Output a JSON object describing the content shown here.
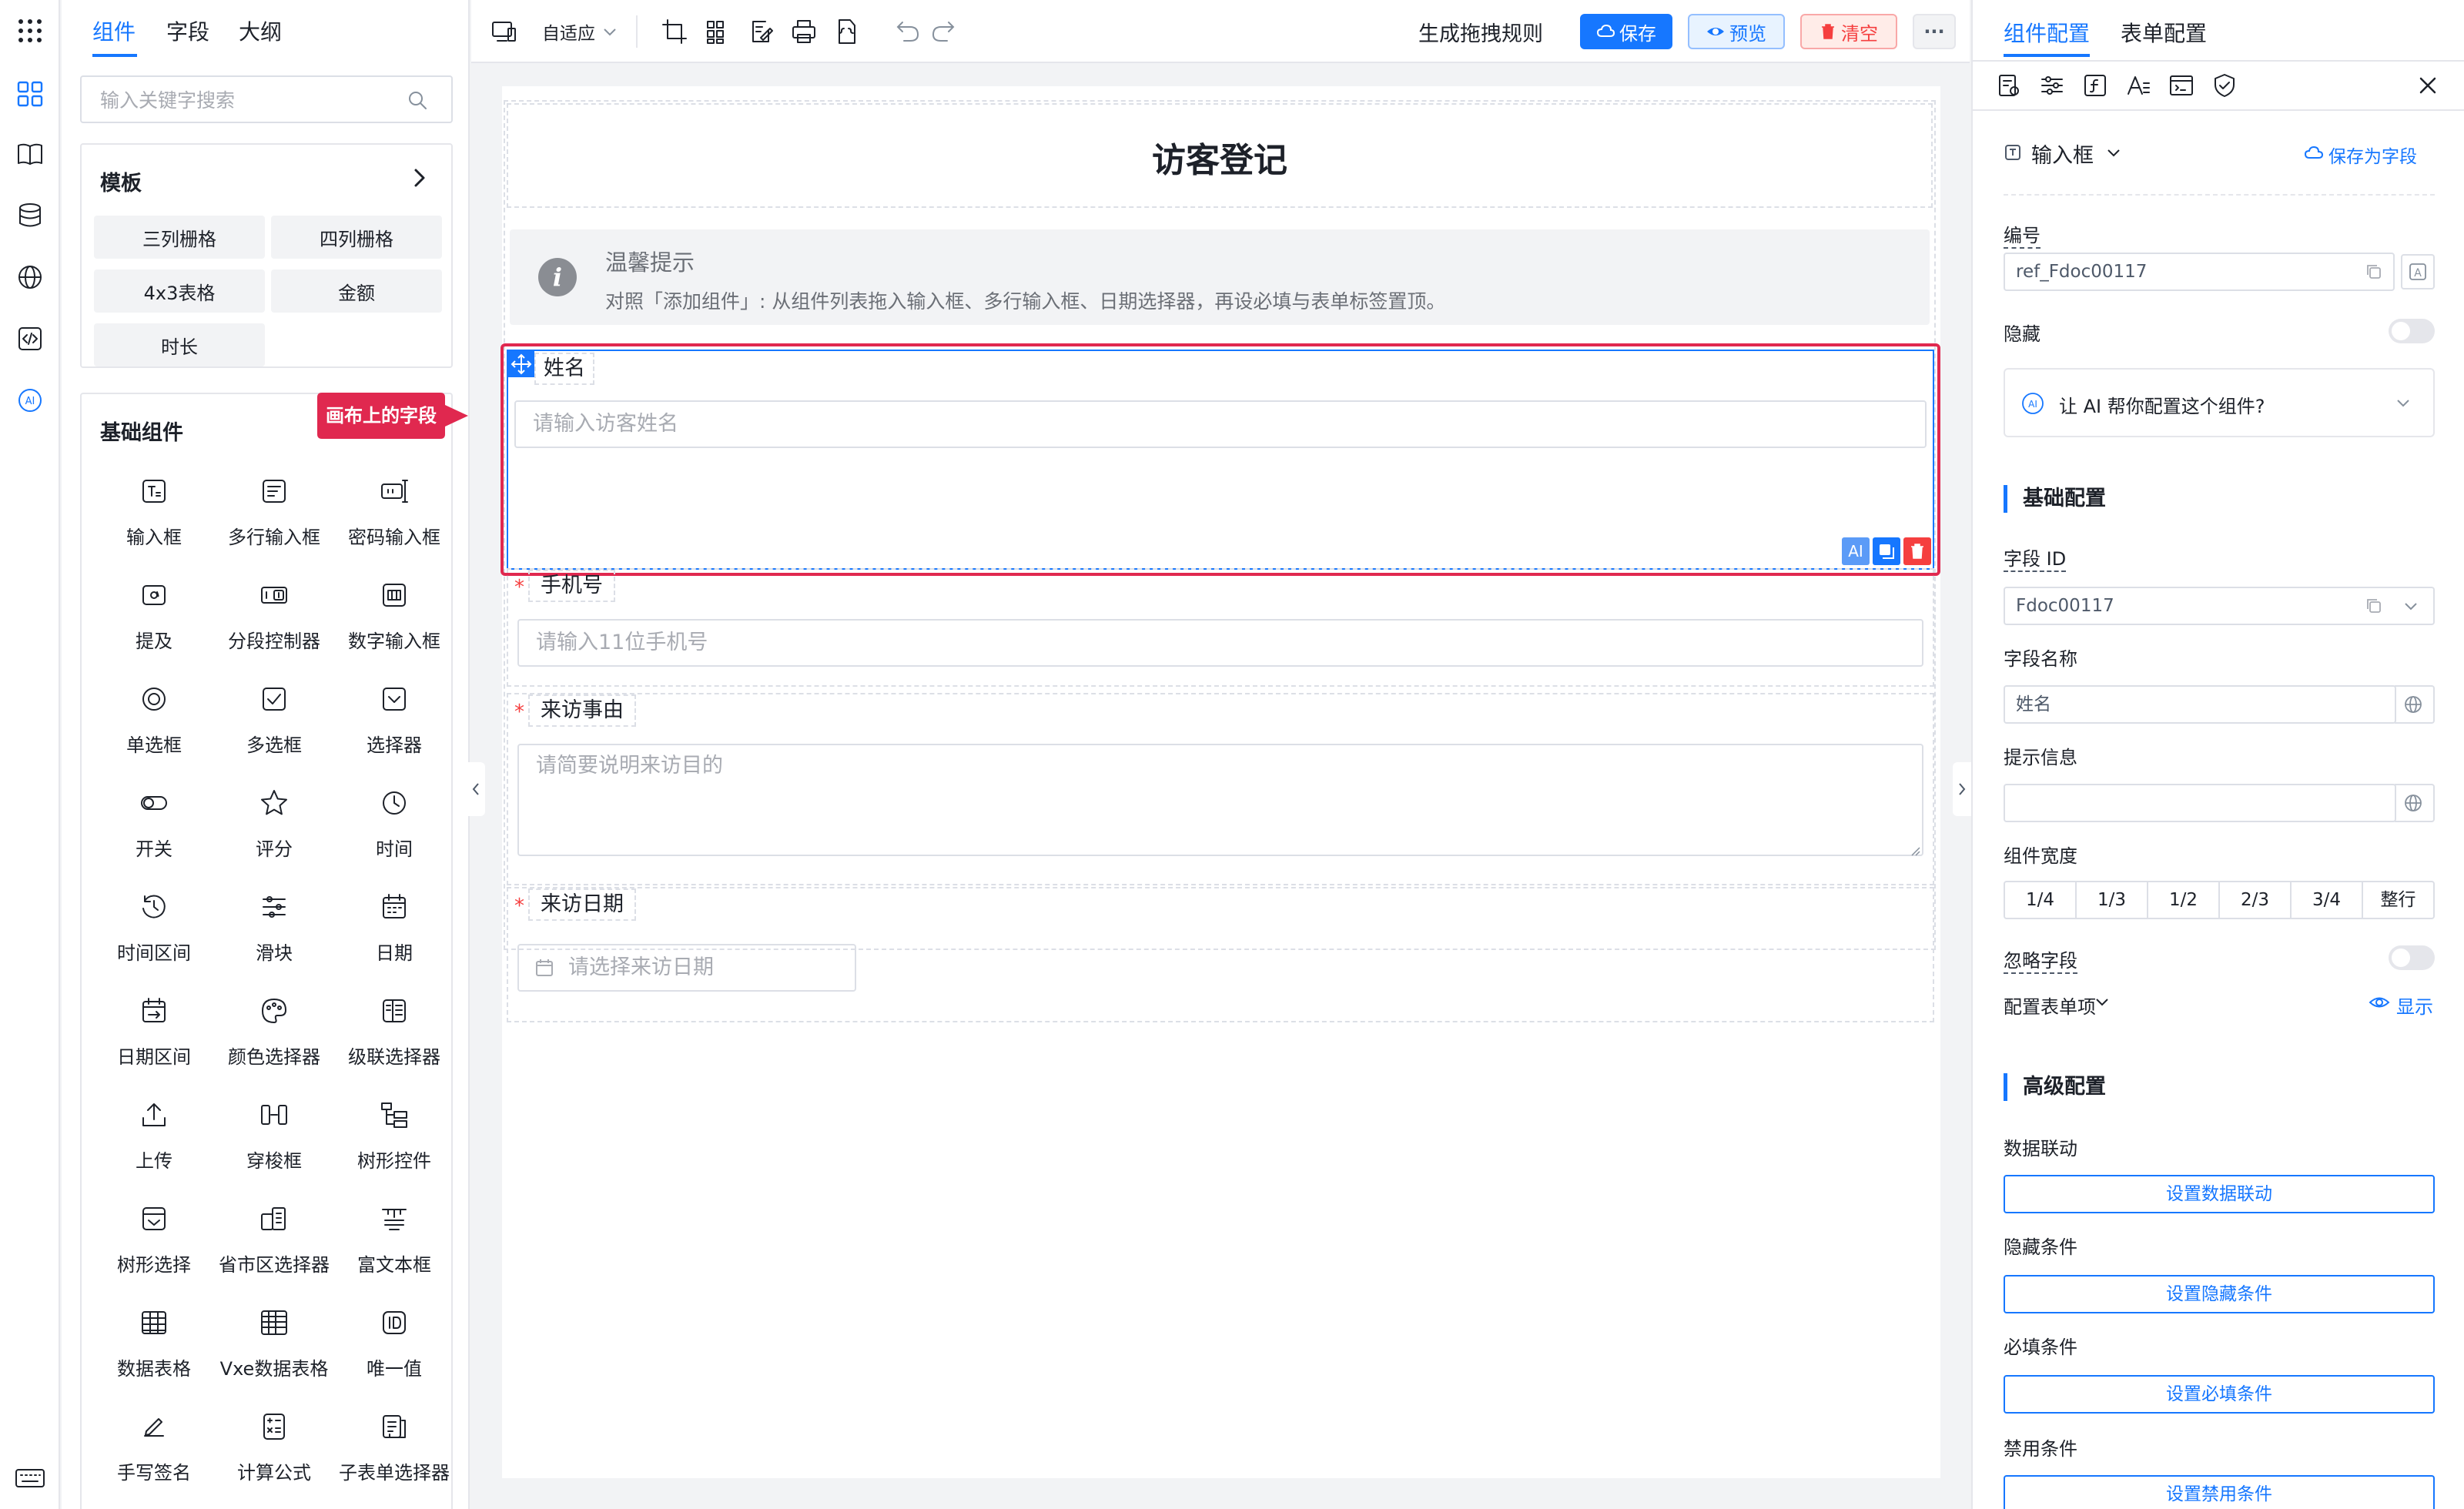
{
  "rail": {
    "icons": [
      "grid-dots-icon",
      "components-icon",
      "book-icon",
      "database-icon",
      "globe-icon",
      "code-icon",
      "ai-icon",
      "keyboard-icon"
    ]
  },
  "left_panel": {
    "tabs": [
      "组件",
      "字段",
      "大纲"
    ],
    "search_placeholder": "输入关键字搜索",
    "templates_title": "模板",
    "templates": [
      "三列栅格",
      "四列栅格",
      "4x3表格",
      "金额",
      "时长"
    ],
    "basic_title": "基础组件",
    "components": [
      "输入框",
      "多行输入框",
      "密码输入框",
      "提及",
      "分段控制器",
      "数字输入框",
      "单选框",
      "多选框",
      "选择器",
      "开关",
      "评分",
      "时间",
      "时间区间",
      "滑块",
      "日期",
      "日期区间",
      "颜色选择器",
      "级联选择器",
      "上传",
      "穿梭框",
      "树形控件",
      "树形选择",
      "省市区选择器",
      "富文本框",
      "数据表格",
      "Vxe数据表格",
      "唯一值",
      "手写签名",
      "计算公式",
      "子表单选择器"
    ]
  },
  "toolbar": {
    "zoom_label": "自适应",
    "generate_label": "生成拖拽规则",
    "save_label": "保存",
    "preview_label": "预览",
    "clear_label": "清空",
    "more_label": "···"
  },
  "canvas": {
    "title": "访客登记",
    "alert_title": "温馨提示",
    "alert_text": "对照「添加组件」: 从组件列表拖入输入框、多行输入框、日期选择器，再设必填与表单标签置顶。",
    "annotation": "画布上的字段",
    "fields": [
      {
        "label": "姓名",
        "placeholder": "请输入访客姓名",
        "required": false
      },
      {
        "label": "手机号",
        "placeholder": "请输入11位手机号",
        "required": true
      },
      {
        "label": "来访事由",
        "placeholder": "请简要说明来访目的",
        "required": true
      },
      {
        "label": "来访日期",
        "placeholder": "请选择来访日期",
        "required": true
      }
    ],
    "field_actions": {
      "ai": "AI"
    }
  },
  "right_panel": {
    "tabs": [
      "组件配置",
      "表单配置"
    ],
    "component_type": "输入框",
    "save_as_field": "保存为字段",
    "ref_label": "编号",
    "ref_value": "ref_Fdoc00117",
    "hidden_label": "隐藏",
    "ai_prompt": "让 AI 帮你配置这个组件?",
    "basic_section": "基础配置",
    "field_id_label": "字段 ID",
    "field_id_value": "Fdoc00117",
    "field_name_label": "字段名称",
    "field_name_value": "姓名",
    "hint_label": "提示信息",
    "hint_value": "",
    "width_label": "组件宽度",
    "width_options": [
      "1/4",
      "1/3",
      "1/2",
      "2/3",
      "3/4",
      "整行"
    ],
    "ignore_label": "忽略字段",
    "form_item_label": "配置表单项",
    "show_label": "显示",
    "advanced_section": "高级配置",
    "linkage_label": "数据联动",
    "linkage_btn": "设置数据联动",
    "hide_cond_label": "隐藏条件",
    "hide_cond_btn": "设置隐藏条件",
    "required_cond_label": "必填条件",
    "required_cond_btn": "设置必填条件",
    "disabled_cond_label": "禁用条件",
    "disabled_cond_btn": "设置禁用条件"
  },
  "colors": {
    "accent": "#1677ff",
    "danger": "#f53f3f",
    "highlight": "#e0284f"
  }
}
